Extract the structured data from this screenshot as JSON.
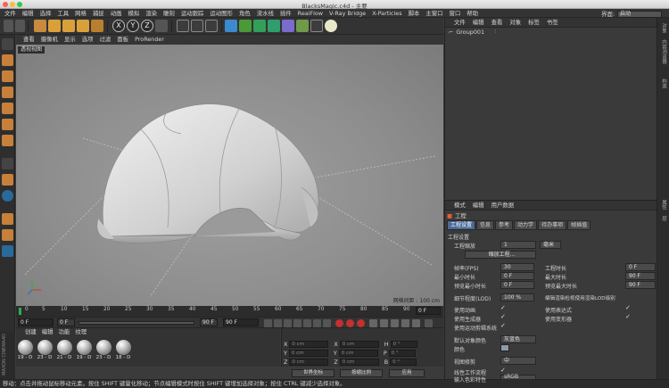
{
  "window": {
    "title": "BlacksMagic.c4d - 主要"
  },
  "menubar": {
    "items": [
      "文件",
      "编辑",
      "选择",
      "工具",
      "网格",
      "捕捉",
      "动画",
      "模拟",
      "渲染",
      "雕刻",
      "运动跟踪",
      "运动图形",
      "角色",
      "流水线",
      "插件",
      "RealFlow",
      "V-Ray Bridge",
      "X-Particles",
      "脚本",
      "主窗口",
      "窗口",
      "帮助"
    ],
    "interface_label": "界面:",
    "interface_value": "启动"
  },
  "toolbar": {
    "axis_buttons": [
      "X",
      "Y",
      "Z"
    ]
  },
  "viewport": {
    "menu": [
      "查看",
      "摄像机",
      "显示",
      "选项",
      "过滤",
      "面板",
      "ProRender"
    ],
    "label": "透视视图",
    "grid_spacing": "网格间距 : 100 cm"
  },
  "timeline": {
    "ticks": [
      "0",
      "5",
      "10",
      "15",
      "20",
      "25",
      "30",
      "35",
      "40",
      "45",
      "50",
      "55",
      "60",
      "65",
      "70",
      "75",
      "80",
      "85",
      "90"
    ],
    "end_frame": "0 F",
    "start": "0 F",
    "start2": "0 F",
    "end": "90 F",
    "end2": "90 F"
  },
  "materials": {
    "menu": [
      "创建",
      "编辑",
      "功能",
      "纹理"
    ],
    "items": [
      "19 - D",
      "23 - D",
      "21 - D",
      "19 - D",
      "23 - D",
      "18 - D"
    ],
    "brand": "MAXON CINEMA4D"
  },
  "coords": {
    "rows": [
      {
        "axis": "X",
        "pos": "0 cm",
        "axis2": "X",
        "size": "0 cm",
        "rot": "H",
        "rot_val": "0 °"
      },
      {
        "axis": "Y",
        "pos": "0 cm",
        "axis2": "Y",
        "size": "0 cm",
        "rot": "P",
        "rot_val": "0 °"
      },
      {
        "axis": "Z",
        "pos": "0 cm",
        "axis2": "Z",
        "size": "0 cm",
        "rot": "B",
        "rot_val": "0 °"
      }
    ],
    "mode1": "世界坐标",
    "mode2": "按缩比例",
    "apply": "应用"
  },
  "objects": {
    "menu": [
      "文件",
      "编辑",
      "查看",
      "对象",
      "标签",
      "书签"
    ],
    "tree": [
      {
        "name": "Group001"
      }
    ]
  },
  "attributes": {
    "menu": [
      "模式",
      "编辑",
      "用户数据"
    ],
    "title": "工程",
    "tabs": [
      "工程设置",
      "信息",
      "参考",
      "动力学",
      "待办事项",
      "帧插值"
    ],
    "section": "工程设置",
    "scale_label": "工程缩放",
    "scale_value": "1",
    "scale_unit": "毫米",
    "scale_btn": "缩放工程...",
    "fps_label": "帧率(FPS)",
    "fps_value": "30",
    "time_label": "工程时长",
    "time_value": "0 F",
    "min_label": "最小时长",
    "min_value": "0 F",
    "max_label": "最大时长",
    "max_value": "90 F",
    "pmin_label": "预览最小时长",
    "pmin_value": "0 F",
    "pmax_label": "预览最大时长",
    "pmax_value": "90 F",
    "lod_label": "细节程度(LOD)",
    "lod_value": "100 %",
    "lod_note": "编辑渲染检视使用渲染LOD级别",
    "use_anim": "使用动画",
    "use_expr": "使用表达式",
    "use_gen": "使用生成器",
    "use_deform": "使用变形器",
    "use_motion": "使用运动剪辑系统",
    "color_label": "默认对象颜色",
    "color_value": "灰蓝色",
    "color2": "颜色",
    "clip_label": "视图修剪",
    "clip_value": "中",
    "linear_label": "线性工作流程",
    "input_label": "输入色彩特性",
    "input_value": "sRGB"
  },
  "right_strip": [
    "对象",
    "内容浏览器",
    "构造",
    "属性",
    "层"
  ],
  "status": {
    "text": "移动：点击并拖动鼠标移动元素。按住 SHIFT 键量化移动；节点编辑模式时按住 SHIFT 键增加选择对象；按住 CTRL 键减少选择对象。"
  },
  "colors": {
    "accent": "#4a6a98",
    "timeline_green": "#2fae4b"
  }
}
